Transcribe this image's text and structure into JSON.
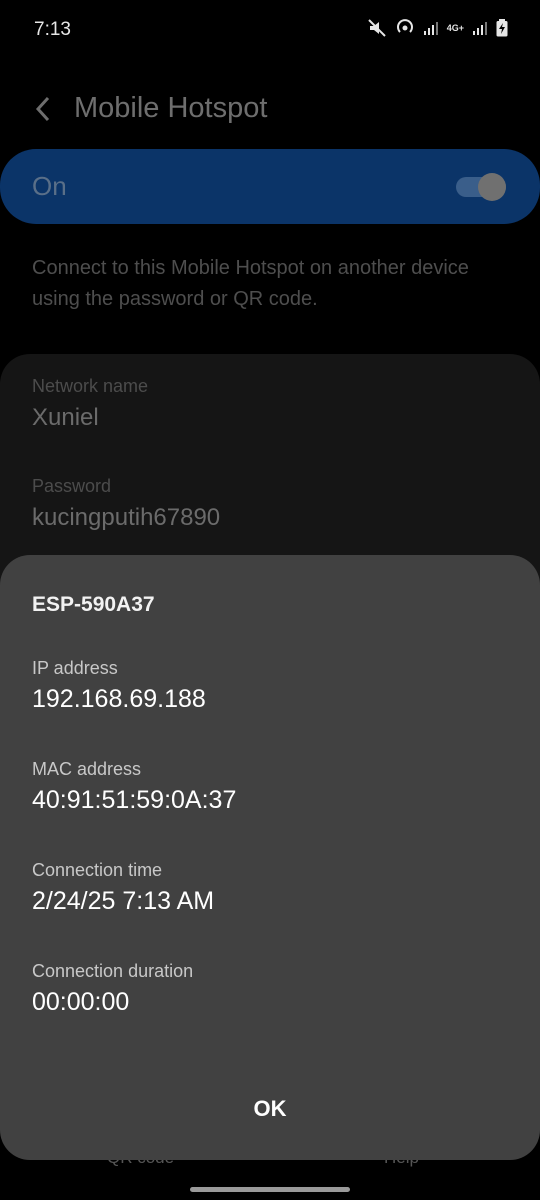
{
  "status_bar": {
    "time": "7:13",
    "network_badge": "4G+"
  },
  "app_bar": {
    "title": "Mobile Hotspot"
  },
  "master_switch": {
    "label": "On",
    "checked": true
  },
  "description": "Connect to this Mobile Hotspot on another device using the password or QR code.",
  "network": {
    "name_label": "Network name",
    "name_value": "Xuniel",
    "password_label": "Password",
    "password_value": "kucingputih67890"
  },
  "bottom_bar": {
    "qr_code": "QR code",
    "help": "Help"
  },
  "dialog": {
    "title": "ESP-590A37",
    "ip_label": "IP address",
    "ip_value": "192.168.69.188",
    "mac_label": "MAC address",
    "mac_value": "40:91:51:59:0A:37",
    "time_label": "Connection time",
    "time_value": "2/24/25 7:13 AM",
    "duration_label": "Connection duration",
    "duration_value": "00:00:00",
    "ok_label": "OK"
  },
  "colors": {
    "accent_blue": "#0b3468",
    "dialog_bg": "#414141",
    "card_bg": "#151515"
  }
}
